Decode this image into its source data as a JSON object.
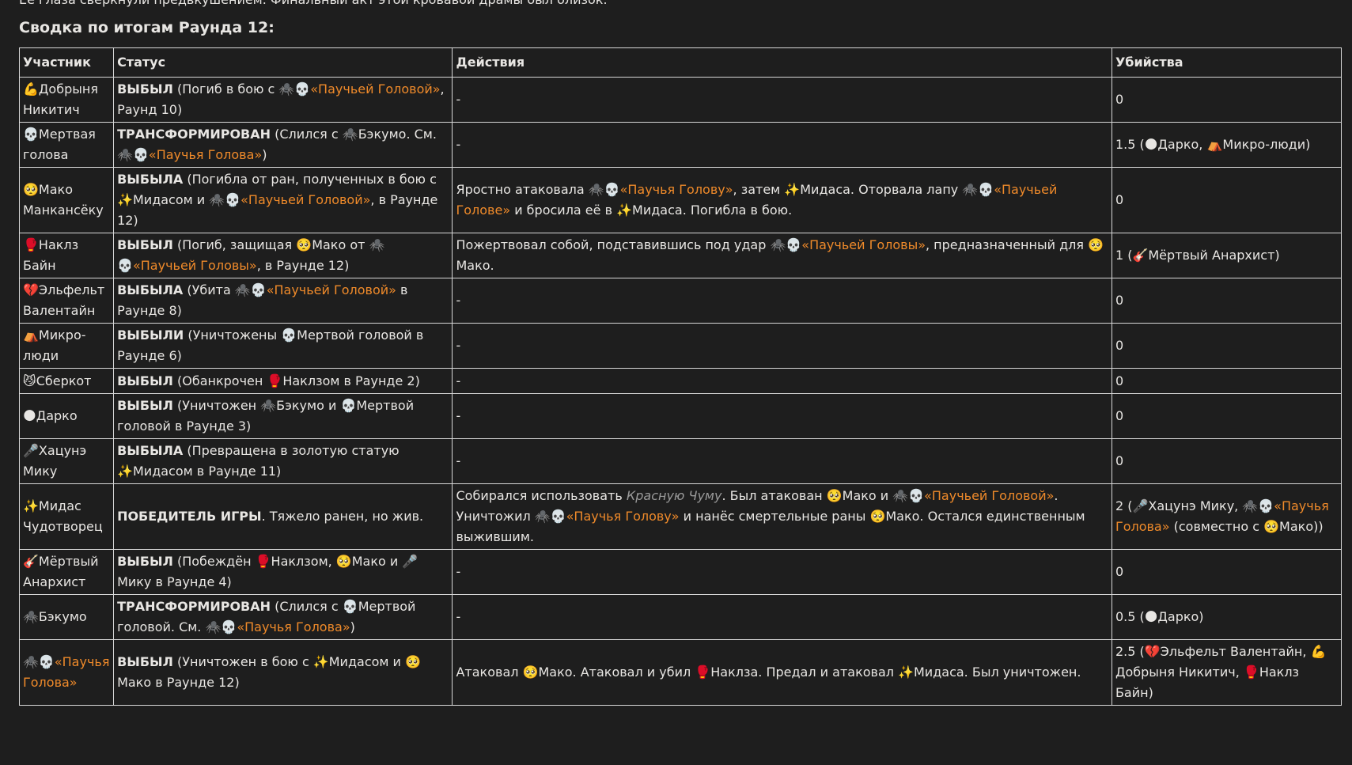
{
  "intro_text": "Её глаза сверкнули предвкушением. Финальный акт этой кровавой драмы был близок.",
  "heading": "Сводка по итогам Раунда 12:",
  "columns": [
    "Участник",
    "Статус",
    "Действия",
    "Убийства"
  ],
  "accent_color": "#ef8a2a",
  "rows": [
    {
      "participant": [
        {
          "t": "💪"
        },
        {
          "t": "Добрыня Никитич"
        }
      ],
      "status": [
        {
          "t": "ВЫБЫЛ",
          "b": true
        },
        {
          "t": " (Погиб в бою с 🕷️💀"
        },
        {
          "t": "«Паучьей Головой»",
          "o": true
        },
        {
          "t": ", Раунд 10)"
        }
      ],
      "actions": [
        {
          "t": "-"
        }
      ],
      "kills": [
        {
          "t": "0"
        }
      ]
    },
    {
      "participant": [
        {
          "t": "💀"
        },
        {
          "t": "Мертвая голова"
        }
      ],
      "status": [
        {
          "t": "ТРАНСФОРМИРОВАН",
          "b": true
        },
        {
          "t": " (Слился с 🕷️Бэкумо. См. 🕷️💀"
        },
        {
          "t": "«Паучья Голова»",
          "o": true
        },
        {
          "t": ")"
        }
      ],
      "actions": [
        {
          "t": "-"
        }
      ],
      "kills": [
        {
          "t": "1.5 (🌑Дарко, ⛺Микро-люди)"
        }
      ]
    },
    {
      "participant": [
        {
          "t": "🥺"
        },
        {
          "t": "Мако Манкансёку"
        }
      ],
      "status": [
        {
          "t": "ВЫБЫЛА",
          "b": true
        },
        {
          "t": " (Погибла от ран, полученных в бою с ✨Мидасом и 🕷️💀"
        },
        {
          "t": "«Паучьей Головой»",
          "o": true
        },
        {
          "t": ", в Раунде 12)"
        }
      ],
      "actions": [
        {
          "t": "Яростно атаковала 🕷️💀"
        },
        {
          "t": "«Паучья Голову»",
          "o": true
        },
        {
          "t": ", затем ✨Мидаса. Оторвала лапу 🕷️💀"
        },
        {
          "t": "«Паучьей Голове»",
          "o": true
        },
        {
          "t": " и бросила её в ✨Мидаса. Погибла в бою."
        }
      ],
      "kills": [
        {
          "t": "0"
        }
      ]
    },
    {
      "participant": [
        {
          "t": "🥊"
        },
        {
          "t": "Наклз Байн"
        }
      ],
      "status": [
        {
          "t": "ВЫБЫЛ",
          "b": true
        },
        {
          "t": " (Погиб, защищая 🥺Мако от 🕷️💀"
        },
        {
          "t": "«Паучьей Головы»",
          "o": true
        },
        {
          "t": ", в Раунде 12)"
        }
      ],
      "actions": [
        {
          "t": "Пожертвовал собой, подставившись под удар 🕷️💀"
        },
        {
          "t": "«Паучьей Головы»",
          "o": true
        },
        {
          "t": ", предназначенный для 🥺Мако."
        }
      ],
      "kills": [
        {
          "t": "1 (🎸Мёртвый Анархист)"
        }
      ]
    },
    {
      "participant": [
        {
          "t": "💔"
        },
        {
          "t": "Эльфельт Валентайн"
        }
      ],
      "status": [
        {
          "t": "ВЫБЫЛА",
          "b": true
        },
        {
          "t": " (Убита 🕷️💀"
        },
        {
          "t": "«Паучьей Головой»",
          "o": true
        },
        {
          "t": " в Раунде 8)"
        }
      ],
      "actions": [
        {
          "t": "-"
        }
      ],
      "kills": [
        {
          "t": "0"
        }
      ]
    },
    {
      "participant": [
        {
          "t": "⛺"
        },
        {
          "t": "Микро-люди"
        }
      ],
      "status": [
        {
          "t": "ВЫБЫЛИ",
          "b": true
        },
        {
          "t": " (Уничтожены 💀Мертвой головой в Раунде 6)"
        }
      ],
      "actions": [
        {
          "t": "-"
        }
      ],
      "kills": [
        {
          "t": "0"
        }
      ]
    },
    {
      "participant": [
        {
          "t": "😼"
        },
        {
          "t": "Сберкот"
        }
      ],
      "status": [
        {
          "t": "ВЫБЫЛ",
          "b": true
        },
        {
          "t": " (Обанкрочен 🥊Наклзом в Раунде 2)"
        }
      ],
      "actions": [
        {
          "t": "-"
        }
      ],
      "kills": [
        {
          "t": "0"
        }
      ]
    },
    {
      "participant": [
        {
          "t": "🌑"
        },
        {
          "t": "Дарко"
        }
      ],
      "status": [
        {
          "t": "ВЫБЫЛ",
          "b": true
        },
        {
          "t": " (Уничтожен 🕷️Бэкумо и 💀Мертвой головой в Раунде 3)"
        }
      ],
      "actions": [
        {
          "t": "-"
        }
      ],
      "kills": [
        {
          "t": "0"
        }
      ]
    },
    {
      "participant": [
        {
          "t": "🎤"
        },
        {
          "t": "Хацунэ Мику"
        }
      ],
      "status": [
        {
          "t": "ВЫБЫЛА",
          "b": true
        },
        {
          "t": " (Превращена в золотую статую ✨Мидасом в Раунде 11)"
        }
      ],
      "actions": [
        {
          "t": "-"
        }
      ],
      "kills": [
        {
          "t": "0"
        }
      ]
    },
    {
      "participant": [
        {
          "t": "✨"
        },
        {
          "t": "Мидас Чудотворец"
        }
      ],
      "status": [
        {
          "t": "ПОБЕДИТЕЛЬ ИГРЫ",
          "b": true
        },
        {
          "t": ". Тяжело ранен, но жив."
        }
      ],
      "actions": [
        {
          "t": "Собирался использовать "
        },
        {
          "t": "Красную Чуму",
          "i": true
        },
        {
          "t": ". Был атакован 🥺Мако и 🕷️💀"
        },
        {
          "t": "«Паучьей Головой»",
          "o": true
        },
        {
          "t": ". Уничтожил 🕷️💀"
        },
        {
          "t": "«Паучья Голову»",
          "o": true
        },
        {
          "t": " и нанёс смертельные раны 🥺Мако. Остался единственным выжившим."
        }
      ],
      "kills": [
        {
          "t": "2 (🎤Хацунэ Мику, 🕷️💀"
        },
        {
          "t": "«Паучья Голова»",
          "o": true
        },
        {
          "t": " (совместно с 🥺Мако))"
        }
      ]
    },
    {
      "participant": [
        {
          "t": "🎸"
        },
        {
          "t": "Мёртвый Анархист"
        }
      ],
      "status": [
        {
          "t": "ВЫБЫЛ",
          "b": true
        },
        {
          "t": " (Побеждён 🥊Наклзом, 🥺Мако и 🎤Мику в Раунде 4)"
        }
      ],
      "actions": [
        {
          "t": "-"
        }
      ],
      "kills": [
        {
          "t": "0"
        }
      ]
    },
    {
      "participant": [
        {
          "t": "🕷️"
        },
        {
          "t": "Бэкумо"
        }
      ],
      "status": [
        {
          "t": "ТРАНСФОРМИРОВАН",
          "b": true
        },
        {
          "t": " (Слился с 💀Мертвой головой. См. 🕷️💀"
        },
        {
          "t": "«Паучья Голова»",
          "o": true
        },
        {
          "t": ")"
        }
      ],
      "actions": [
        {
          "t": "-"
        }
      ],
      "kills": [
        {
          "t": "0.5 (🌑Дарко)"
        }
      ]
    },
    {
      "participant": [
        {
          "t": "🕷️💀"
        },
        {
          "t": "«Паучья Голова»",
          "o": true
        }
      ],
      "status": [
        {
          "t": "ВЫБЫЛ",
          "b": true
        },
        {
          "t": " (Уничтожен в бою с ✨Мидасом и 🥺Мако в Раунде 12)"
        }
      ],
      "actions": [
        {
          "t": "Атаковал 🥺Мако. Атаковал и убил 🥊Наклза. Предал и атаковал ✨Мидаса. Был уничтожен."
        }
      ],
      "kills": [
        {
          "t": "2.5 (💔Эльфельт Валентайн, 💪Добрыня Никитич, 🥊Наклз Байн)"
        }
      ]
    }
  ]
}
